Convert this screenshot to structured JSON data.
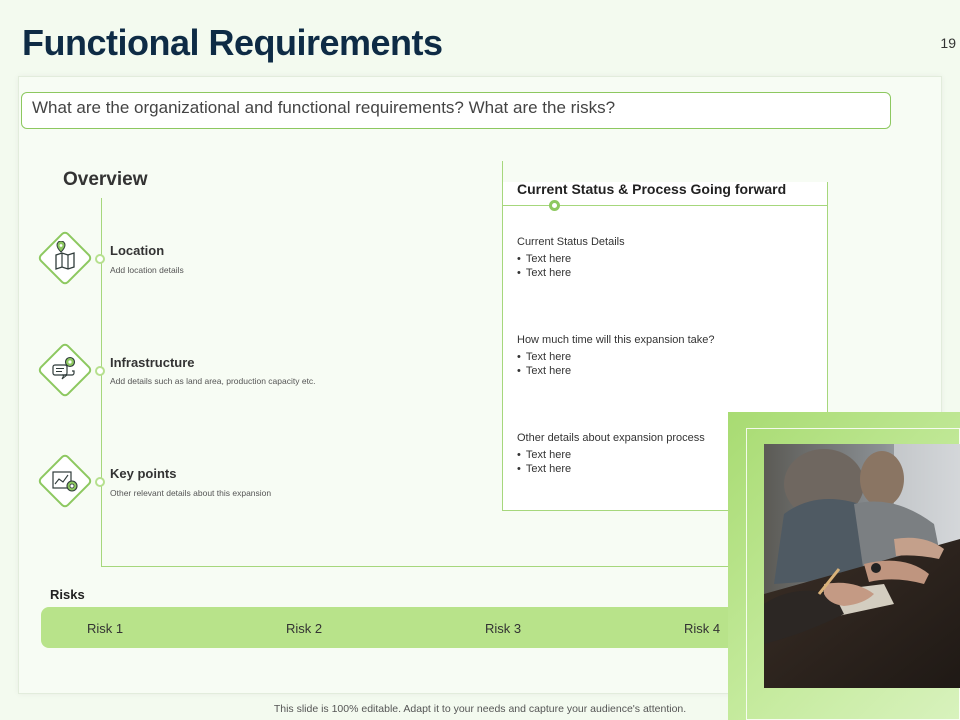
{
  "slide": {
    "title": "Functional Requirements",
    "page_number": "19",
    "question": "What are the organizational and functional requirements? What are the risks?",
    "footer": "This slide is 100% editable. Adapt it to your needs and capture your audience's attention."
  },
  "overview": {
    "title": "Overview",
    "items": [
      {
        "label": "Location",
        "desc": "Add location details",
        "icon": "map-location-icon"
      },
      {
        "label": "Infrastructure",
        "desc": "Add details such as land area, production capacity etc.",
        "icon": "gear-chat-icon"
      },
      {
        "label": "Key points",
        "desc": "Other relevant details about this expansion",
        "icon": "chart-target-icon"
      }
    ]
  },
  "status": {
    "title": "Current Status & Process Going forward",
    "sections": [
      {
        "heading": "Current Status Details",
        "bullets": [
          "Text here",
          "Text here"
        ]
      },
      {
        "heading": "How much time will this expansion take?",
        "bullets": [
          "Text here",
          "Text here"
        ]
      },
      {
        "heading": "Other details about expansion process",
        "bullets": [
          "Text here",
          "Text here"
        ]
      }
    ]
  },
  "risks": {
    "title": "Risks",
    "items": [
      "Risk 1",
      "Risk 2",
      "Risk 3",
      "Risk 4"
    ]
  },
  "colors": {
    "accent_green": "#8dc860",
    "bar_green": "#b8e38a",
    "title_navy": "#0e2b45"
  }
}
